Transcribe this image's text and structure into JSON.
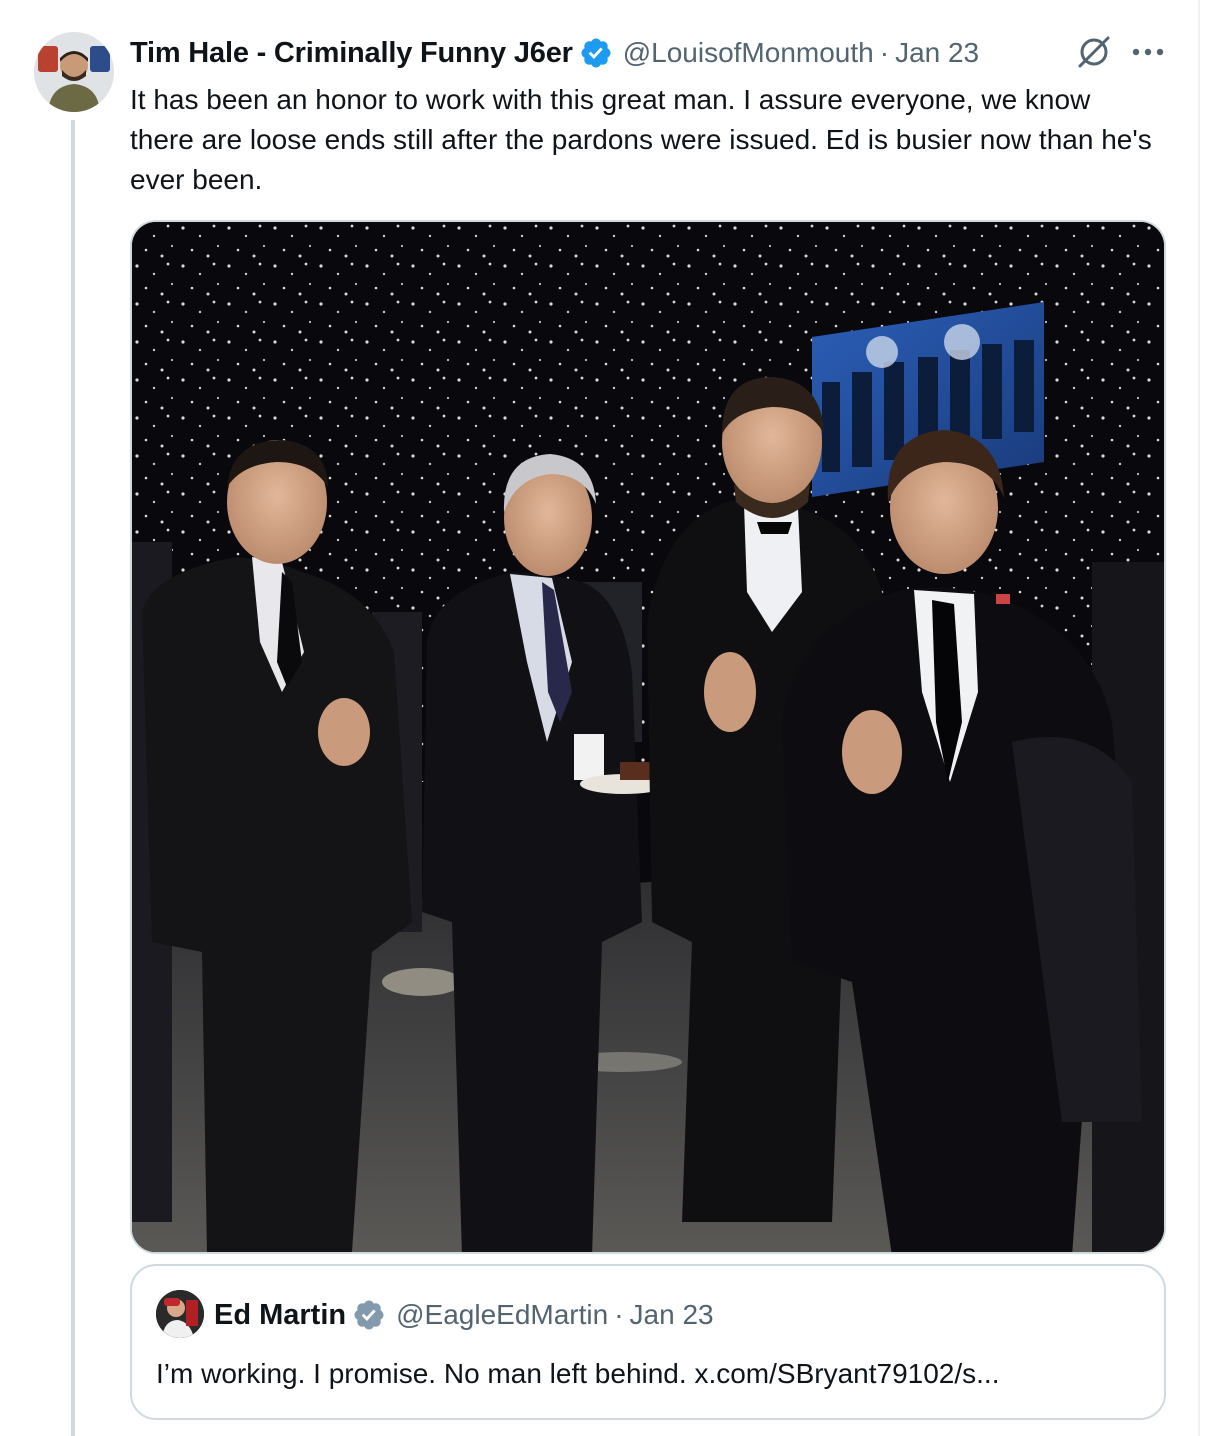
{
  "tweet": {
    "display_name": "Tim Hale - Criminally Funny J6er",
    "handle": "@LouisofMonmouth",
    "separator": "·",
    "date": "Jan 23",
    "text": "It has been an honor to work with this great man. I assure everyone, we know there are loose ends still after the pardons were issued. Ed is busier now than he's ever been.",
    "verified_color": "#1d9bf0",
    "icons": {
      "avatar": "user-avatar",
      "verified": "verified-badge-icon",
      "grok": "grok-icon",
      "more": "more-horizontal-icon"
    }
  },
  "quote": {
    "display_name": "Ed Martin",
    "handle": "@EagleEdMartin",
    "separator": "·",
    "date": "Jan 23",
    "text": "I’m working.  I promise. No man left behind. x.com/SBryant79102/s...",
    "verified_color": "#829aab"
  },
  "colors": {
    "text": "#0f1419",
    "secondary": "#536471",
    "border": "#cfd9de",
    "thread_line": "#cfd9de"
  }
}
